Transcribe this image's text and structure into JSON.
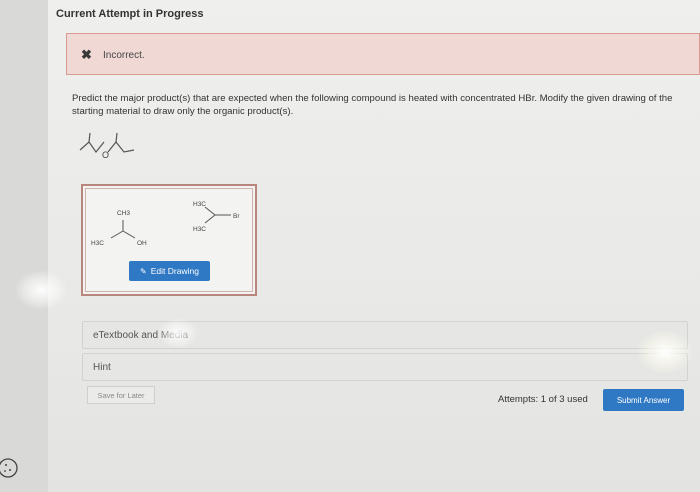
{
  "header": {
    "title": "Current Attempt in Progress"
  },
  "feedback": {
    "status": "Incorrect."
  },
  "question": {
    "text": "Predict the major product(s) that are expected when the following compound is heated with concentrated HBr. Modify the given drawing of the starting material to draw only the organic product(s)."
  },
  "starting_material": {
    "heteroatom": "O"
  },
  "drawing": {
    "product1": {
      "top_label": "CH3",
      "left_label": "H3C",
      "right_label": "OH"
    },
    "product2": {
      "top_label": "H3C",
      "bottom_label": "H3C",
      "right_label": "Br"
    },
    "edit_button": "Edit Drawing"
  },
  "resources": {
    "etextbook": "eTextbook and Media",
    "hint": "Hint"
  },
  "footer": {
    "save_later": "Save for Later",
    "attempts": "Attempts: 1 of 3 used",
    "submit": "Submit Answer"
  },
  "colors": {
    "accent": "#2f78c4",
    "error_bg": "#f0d9d5",
    "error_border": "#d99a92"
  }
}
